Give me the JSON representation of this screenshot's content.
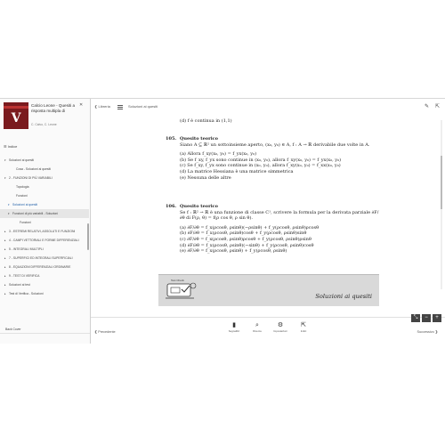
{
  "book": {
    "title": "Calcio Leone - Quesiti a risposta multipla di",
    "authors": "C. Calvo, C. Leone",
    "cover_letter": "V",
    "cover_color": "#7a1a1e"
  },
  "sidebar": {
    "index_label": "Indice",
    "items": [
      {
        "label": "Soluzioni ai quesiti",
        "caret": "▾",
        "indent": 0
      },
      {
        "label": "Cosa - Soluzioni ai quesiti",
        "caret": "",
        "indent": 2
      },
      {
        "label": "2 - FUNZIONI DI PIÙ VARIABILI",
        "caret": "▾",
        "indent": 0
      },
      {
        "label": "Topologia",
        "caret": "",
        "indent": 2
      },
      {
        "label": "Funzioni",
        "caret": "",
        "indent": 2
      },
      {
        "label": "Soluzioni ai quesiti",
        "caret": "▾",
        "indent": 1,
        "active": true
      },
      {
        "label": "Funzioni di più variabili - Soluzioni",
        "caret": "▾",
        "indent": 1,
        "highlight": true
      },
      {
        "label": "Funzioni",
        "caret": "",
        "indent": 3
      },
      {
        "label": "3 - ESTREMI RELATIVI, ASSOLUTI E FUNZIONI",
        "caret": "▸",
        "indent": 0
      },
      {
        "label": "4 - CAMPI VETTORIALI E FORME DIFFERENZIALI",
        "caret": "▸",
        "indent": 0
      },
      {
        "label": "5 - INTEGRALI MULTIPLI",
        "caret": "▸",
        "indent": 0
      },
      {
        "label": "7 - SUPERFICI ED INTEGRALI SUPERFICIALI",
        "caret": "▸",
        "indent": 0
      },
      {
        "label": "8 - EQUAZIONI DIFFERENZIALI ORDINARIE",
        "caret": "▸",
        "indent": 0
      },
      {
        "label": "9 - TEST DI VERIFICA",
        "caret": "▸",
        "indent": 0
      },
      {
        "label": "Soluzioni ai test",
        "caret": "▸",
        "indent": 0
      },
      {
        "label": "Test di Verifica - Soluzioni",
        "caret": "▸",
        "indent": 0
      }
    ],
    "back_cover": "Back Cover"
  },
  "topbar": {
    "back_label": "Libreria",
    "breadcrumb": "Soluzioni ai quesiti"
  },
  "content": {
    "prev_tail": "(d) f è continua in (1,1)",
    "q105": {
      "number": "105.",
      "title": "Quesito teorico",
      "body": "Siano A ⊆ ℝ² un sottoinsieme aperto, (x₀, y₀) ∈ A, f : A → ℝ derivabile due volte in A.",
      "options": [
        "(a) Allora f_xy(x₀, y₀) = f_yx(x₀, y₀)",
        "(b) Se f_xy, f_yx sono continue in (x₀, y₀), allora f_xy(x₀, y₀) = f_yx(x₀, y₀)",
        "(c) Se f_xy, f_yx sono continue in (x₀, y₀), allora f_xy(x₀, y₀) = f_xx(x₀, y₀)",
        "(d) La matrice Hessiana è una matrice simmetrica",
        "(e) Nessuna delle altre"
      ]
    },
    "q106": {
      "number": "106.",
      "title": "Quesito teorico",
      "body": "Se f : ℝ² → ℝ è una funzione di classe C¹, scrivere la formula per la derivata parziale ∂F/∂θ di F(ρ, θ) = f(ρ cos θ, ρ sin θ).",
      "options": [
        "(a) ∂F/∂θ = f_x(ρcosθ, ρsinθ)(−ρsinθ) + f_y(ρcosθ, ρsinθ)ρcosθ",
        "(b) ∂F/∂θ = f_x(ρcosθ, ρsinθ)cosθ + f_y(ρcosθ, ρsinθ)sinθ",
        "(c) ∂F/∂θ = f_x(ρcosθ, ρsinθ)ρcosθ + f_y(ρcosθ, ρsinθ)ρsinθ",
        "(d) ∂F/∂θ = f_x(ρcosθ, ρsinθ)(−sinθ) + f_y(ρcosθ, ρsinθ)cosθ",
        "(e) ∂F/∂θ = f_x(ρcosθ, ρsinθ) + f_y(ρcosθ, ρsinθ)"
      ]
    },
    "banner_text": "Soluzioni ai quesiti",
    "banner_label": "Test Check"
  },
  "zoom": {
    "fit": "⤡",
    "out": "−",
    "in": "+"
  },
  "bottombar": {
    "prev_label": "Precedente",
    "next_label": "Successivo",
    "tools": [
      {
        "icon": "▮",
        "label": "Segnalibri"
      },
      {
        "icon": "⌕",
        "label": "Ricerca"
      },
      {
        "icon": "⚙",
        "label": "Impostazioni"
      },
      {
        "icon": "⇱",
        "label": "Indici"
      }
    ]
  }
}
